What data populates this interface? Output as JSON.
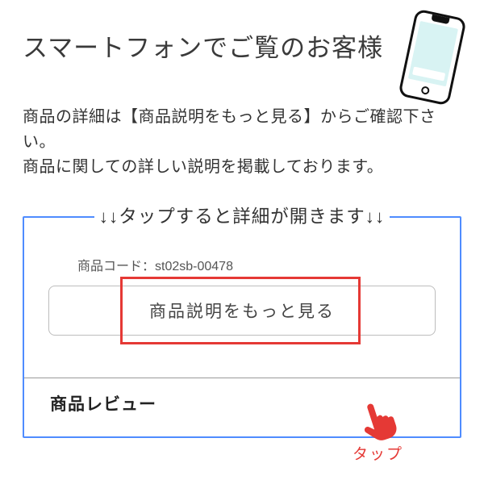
{
  "title": "スマートフォンでご覧のお客様",
  "lead_line1": "商品の詳細は【商品説明をもっと見る】からご確認下さい。",
  "lead_line2": "商品に関しての詳しい説明を掲載しております。",
  "panel": {
    "caption": "↓↓タップすると詳細が開きます↓↓",
    "code_label": "商品コード：",
    "code_value": "st02sb-00478",
    "expand_button": "商品説明をもっと見る",
    "tap_label": "タップ",
    "review_heading": "商品レビュー"
  }
}
